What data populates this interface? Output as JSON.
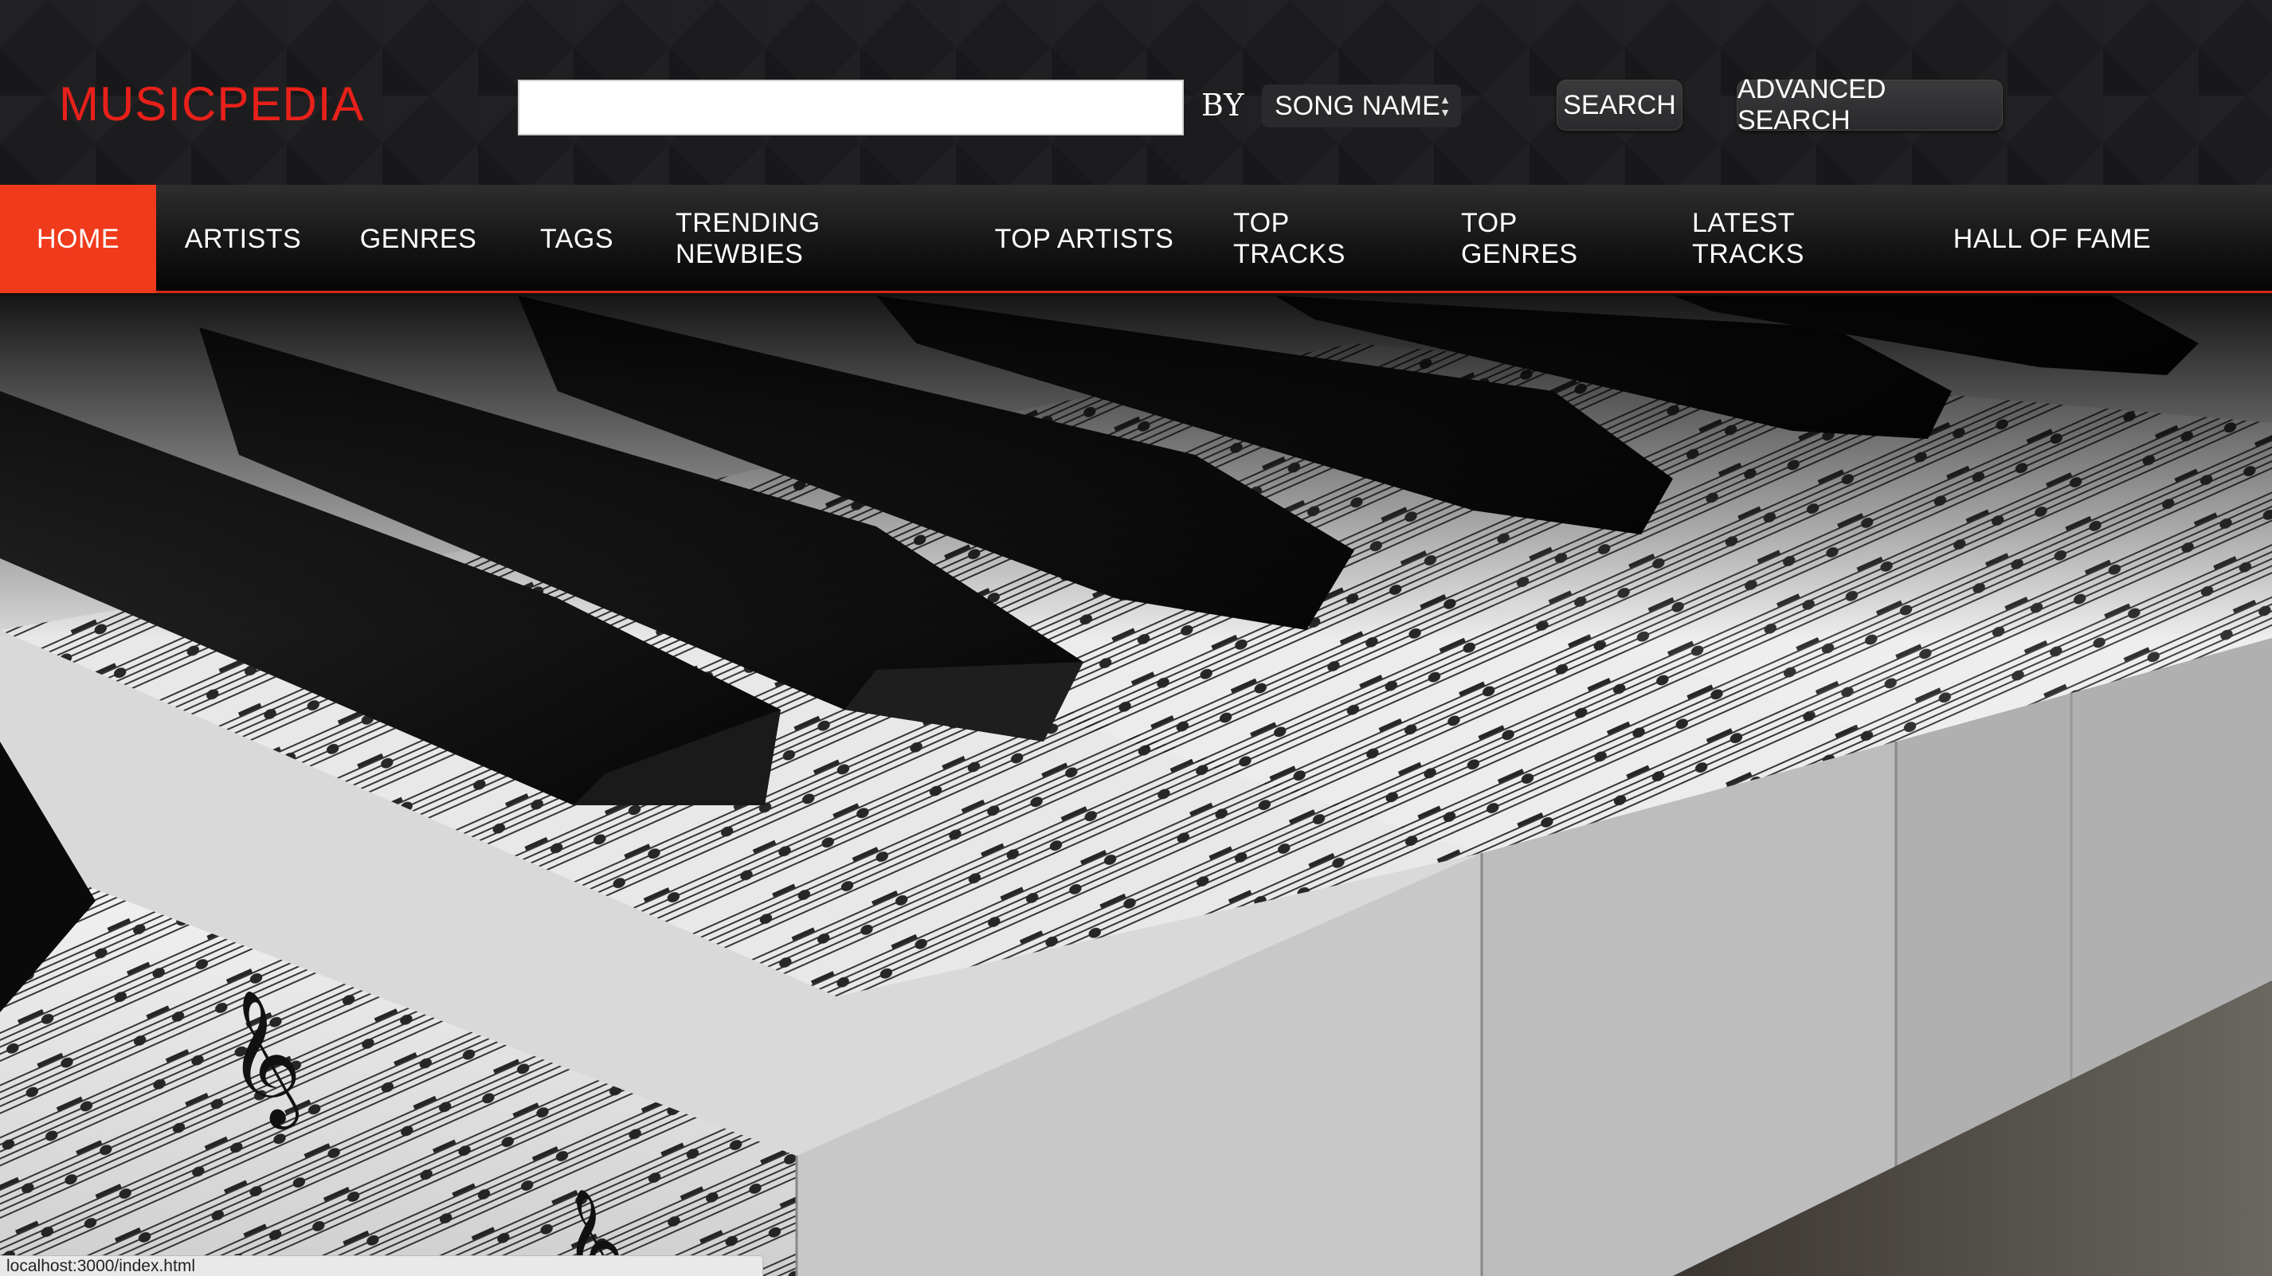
{
  "brand": {
    "logo_text": "MUSICPEDIA",
    "accent_color": "#e8201a"
  },
  "search": {
    "query_value": "",
    "placeholder": "",
    "by_label": "BY",
    "by_select_value": "SONG NAME",
    "search_button": "SEARCH",
    "advanced_button": "ADVANCED SEARCH"
  },
  "nav": {
    "items": [
      {
        "label": "HOME",
        "active": true
      },
      {
        "label": "ARTISTS"
      },
      {
        "label": "GENRES"
      },
      {
        "label": "TAGS"
      },
      {
        "label": "TRENDING NEWBIES"
      },
      {
        "label": "TOP ARTISTS"
      },
      {
        "label": "TOP TRACKS"
      },
      {
        "label": "TOP GENRES"
      },
      {
        "label": "LATEST TRACKS"
      },
      {
        "label": "HALL OF FAME"
      }
    ],
    "active_color": "#f03a1c"
  },
  "hero": {
    "icon": "piano-sheet-music-image"
  },
  "status_bar": {
    "url": "localhost:3000/index.html"
  }
}
